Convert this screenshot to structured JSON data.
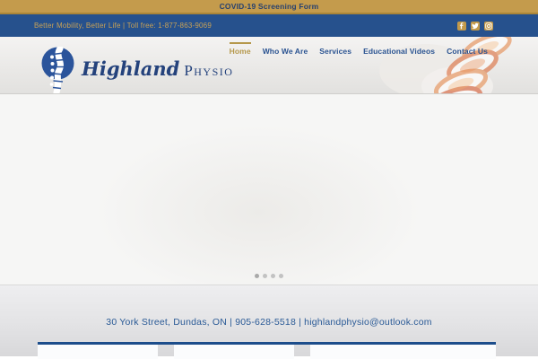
{
  "colors": {
    "gold": "#c49b4c",
    "gold_dark": "#aa8538",
    "navy_bar": "#26518d",
    "nav_link_blue": "#2a5391",
    "nav_active_gold": "#b5984b",
    "brand_navy": "#24427c",
    "footer_text_blue": "#2a5a96",
    "widget_border_blue": "#1c4d8b"
  },
  "topbar": {
    "covid_link_label": "COVID-19 Screening Form"
  },
  "infobar": {
    "tagline": "Better Mobility, Better Life | Toll free: 1-877-863-9069",
    "social_icons": [
      "facebook",
      "twitter",
      "instagram"
    ]
  },
  "header": {
    "brand": {
      "script_word": "Highland",
      "serif_word": "Physio"
    },
    "nav": [
      {
        "label": "Home",
        "active": true
      },
      {
        "label": "Who We Are",
        "active": false
      },
      {
        "label": "Services",
        "active": false
      },
      {
        "label": "Educational Videos",
        "active": false
      },
      {
        "label": "Contact Us",
        "active": false
      }
    ]
  },
  "slider": {
    "dot_count": 4,
    "active_dot_index": 0
  },
  "footer": {
    "contact_line": "30 York Street, Dundas, ON  |  905-628-5518 | highlandphysio@outlook.com"
  }
}
